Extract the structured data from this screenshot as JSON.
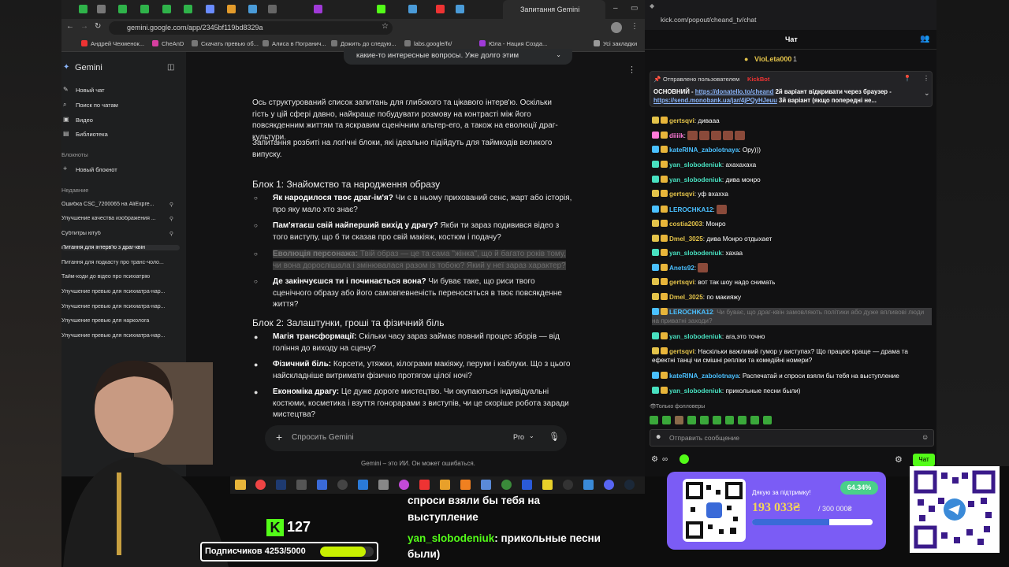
{
  "browser": {
    "active_tab": "Запитання Gemini",
    "url": "gemini.google.com/app/2345bf119bd8329a",
    "bookmarks": [
      "Андрей Чехменок...",
      "CheAnD",
      "Скачать превью об...",
      "Алиса в Погранич...",
      "Дожить до следую...",
      "labs.google/fx/",
      "Юла - Нация Созда...",
      "Усі закладки"
    ]
  },
  "gemini": {
    "brand": "Gemini",
    "new_chat": "Новый чат",
    "search": "Поиск по чатам",
    "video": "Видео",
    "library": "Библиотека",
    "notebooks": "Блокноты",
    "new_notebook": "Новый блокнот",
    "recent_label": "Недавние",
    "recent": [
      "Ошибка CSC_7200065 на AliExpre...",
      "Улучшение качества изображения ...",
      "Субтитры ютуб",
      "Питання для інтерв'ю з драг-квін",
      "Питання для подкасту про транс-чоло...",
      "Тайм-коди до відео про психіатрію",
      "Улучшение превью для психиатра-нар...",
      "Улучшение превью для психиатра-нар...",
      "Улучшение превью для нарколога",
      "Улучшение превью для психиатра-нар..."
    ],
    "top_fragment": "какие-то интересные вопросы. Уже долго этим",
    "intro": "Ось структурований список запитань для глибокого та цікавого інтерв'ю. Оскільки гість у цій сфері давно, найкраще побудувати розмову на контрасті між його повсякденним життям та яскравим сценічним альтер-его, а також на еволюції драг-культури.",
    "intro2": "Запитання розбиті на логічні блоки, які ідеально підійдуть для таймкодів великого випуску.",
    "block1": "Блок 1: Знайомство та народження образу",
    "b1_items": [
      {
        "bold": "Як народилося твоє драг-ім'я?",
        "rest": " Чи є в ньому прихований сенс, жарт або історія, про яку мало хто знає?"
      },
      {
        "bold": "Пам'ятаєш свій найперший вихід у драгу?",
        "rest": " Якби ти зараз подивився відео з того виступу, що б ти сказав про свій макіяж, костюм і подачу?"
      },
      {
        "bold": "Еволюція персонажа:",
        "rest": " Твій образ — це та сама \"жінка\", що й багато років тому, чи вона дорослішала і змінювалася разом із тобою? Який у неї зараз характер?"
      },
      {
        "bold": "Де закінчуєшся ти і починається вона?",
        "rest": " Чи буває таке, що риси твого сценічного образу або його самовпевненість переносяться в твоє повсякденне життя?"
      }
    ],
    "block2": "Блок 2: Залаштунки, гроші та фізичний біль",
    "b2_items": [
      {
        "bold": "Магія трансформації:",
        "rest": " Скільки часу зараз займає повний процес зборів — від гоління до виходу на сцену?"
      },
      {
        "bold": "Фізичний біль:",
        "rest": " Корсети, утяжки, кілограми макіяжу, перуки і каблуки. Що з цього найскладніше витримати фізично протягом цілої ночі?"
      },
      {
        "bold": "Економіка драгу:",
        "rest": " Це дуже дороге мистецтво. Чи окупаються індивідуальні костюми, косметика і взуття гонорарами з виступів, чи це скоріше робота заради мистецтва?"
      }
    ],
    "prompt_placeholder": "Спросить Gemini",
    "mode": "Pro",
    "disclaimer": "Gemini – это ИИ. Он может ошибаться."
  },
  "chat": {
    "url": "kick.com/popout/cheand_tv/chat",
    "title": "Чат",
    "top_gifter": "VioLeta000",
    "top_gifter_count": "1",
    "pinned_by": "Отправлено пользователем",
    "pinned_user": "KickBot",
    "pinned_text1": "ОСНОВНИЙ - ",
    "pinned_link1": "https://donatello.to/cheand",
    "pinned_text2": " 2й варіант відкривати через браузер - ",
    "pinned_link2": "https://send.monobank.ua/jar/4jPQyHJeuu",
    "pinned_text3": " 3й варіант (якщо попередні не...",
    "messages": [
      {
        "user": "gertsqvi",
        "text": ": дивааа",
        "color": "ye"
      },
      {
        "user": "diiiik",
        "text": ":",
        "color": "pk",
        "emotes": 5
      },
      {
        "user": "kateRINA_zabolotnaya",
        "text": ": Ору)))",
        "color": "bl"
      },
      {
        "user": "yan_slobodeniuk",
        "text": ": ахахахаха",
        "color": "tl"
      },
      {
        "user": "yan_slobodeniuk",
        "text": ": дива монро",
        "color": "tl"
      },
      {
        "user": "gertsqvi",
        "text": ": уф вхахха",
        "color": "ye"
      },
      {
        "user": "LEROCHKA12",
        "text": ":",
        "color": "bl",
        "emotes": 1
      },
      {
        "user": "costia2003",
        "text": ": Монро",
        "color": "ye"
      },
      {
        "user": "Dmel_3025",
        "text": ": дива Монро отдыхает",
        "color": "ye"
      },
      {
        "user": "yan_slobodeniuk",
        "text": ": хахаа",
        "color": "tl"
      },
      {
        "user": "Anets92",
        "text": ":",
        "color": "bl",
        "emotes": 1
      },
      {
        "user": "gertsqvi",
        "text": ": вот так шоу надо снимать",
        "color": "ye"
      },
      {
        "user": "Dmel_3025",
        "text": ": по макияжу",
        "color": "ye"
      },
      {
        "user": "LEROCHKA12",
        "text": ": Чи буває, що драг-квін замовляють політики або дуже впливові люди на приватні заходи?",
        "color": "bl",
        "hl": true
      },
      {
        "user": "yan_slobodeniuk",
        "text": ": ага,это точно",
        "color": "tl"
      },
      {
        "user": "gertsqvi",
        "text": ": Наскільки важливий гумор у виступах? Що працює краще — драма та ефектні танці чи смішні репліки та комедійні номери?",
        "color": "ye"
      },
      {
        "user": "kateRINA_zabolotnaya",
        "text": ": Распечатай и спроси взяли бы тебя на выступление",
        "color": "bl"
      },
      {
        "user": "yan_slobodeniuk",
        "text": ": прикольные песни были)",
        "color": "tl"
      }
    ],
    "followers_only": "Только фолловеры",
    "input_placeholder": "Отправить сообщение",
    "send": "Чат"
  },
  "overlay": {
    "caption1": "спроси взяли бы тебя на",
    "caption2": "выступление",
    "caption_user": "yan_slobodeniuk",
    "caption3": ": прикольные песни",
    "caption4": "были)",
    "kick_viewers": "127",
    "subs": "Подписчиков 4253/5000",
    "subs_progress": 0.8506,
    "donate_title": "Дякую за підтримку!",
    "donate_percent": "64.34%",
    "donate_amount": "193 033₴",
    "donate_goal": "/ 300 000₴",
    "donate_progress": 0.6434
  },
  "colors": {
    "kick_green": "#53fc18",
    "donate_purple": "#7b5cf5",
    "gemini_bg": "#131314"
  }
}
